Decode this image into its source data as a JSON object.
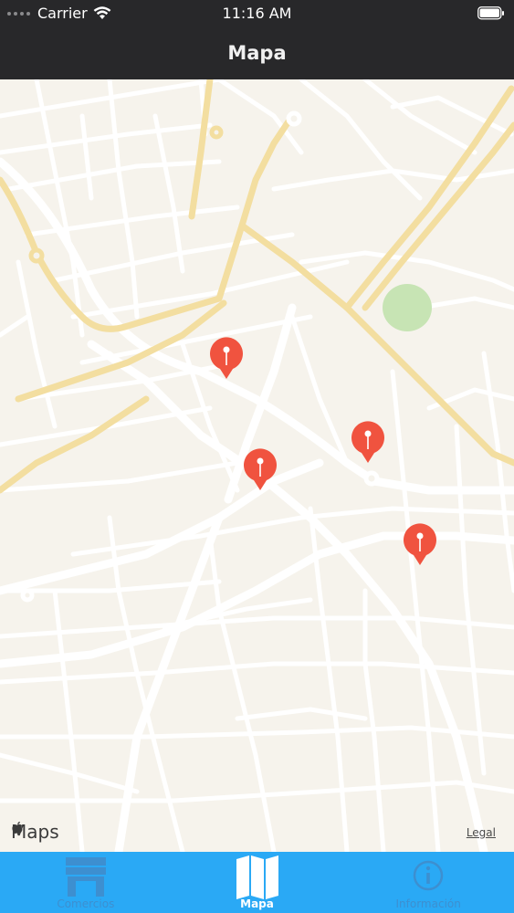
{
  "status_bar": {
    "carrier": "Carrier",
    "time": "11:16 AM",
    "icons": [
      "signal-dots-icon",
      "wifi-icon",
      "battery-icon"
    ]
  },
  "nav_bar": {
    "title": "Mapa"
  },
  "map": {
    "attribution": "Maps",
    "legal": "Legal",
    "pin_color": "#f0533f",
    "pins": [
      "map-pin-1",
      "map-pin-2",
      "map-pin-3",
      "map-pin-4"
    ]
  },
  "tab_bar": {
    "background": "#2aa9f5",
    "tabs": [
      {
        "label": "Comercios",
        "icon": "store-icon",
        "active": false
      },
      {
        "label": "Mapa",
        "icon": "map-icon",
        "active": true
      },
      {
        "label": "Información",
        "icon": "info-icon",
        "active": false
      }
    ]
  }
}
